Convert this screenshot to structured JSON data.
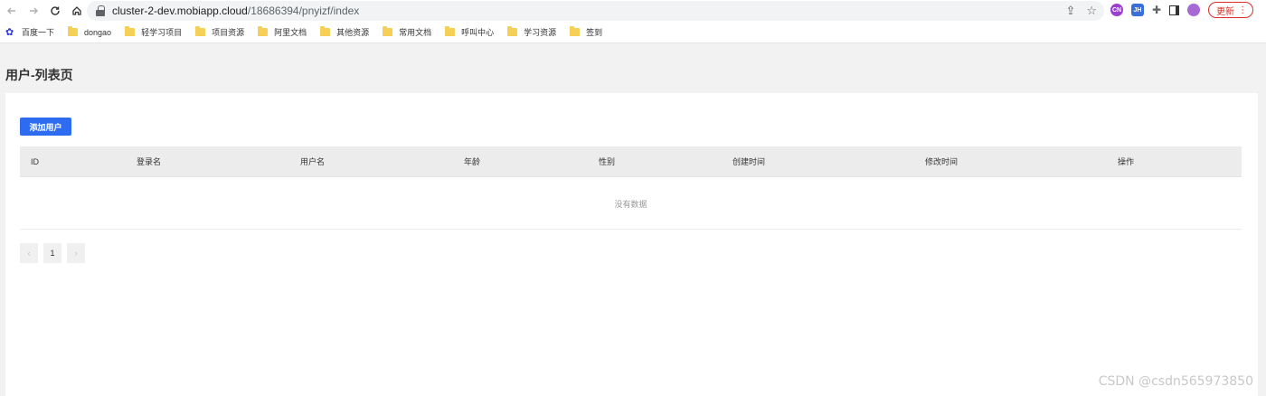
{
  "browser": {
    "url_host": "cluster-2-dev.mobiapp.cloud",
    "url_path": "/18686394/pnyizf/index",
    "update_label": "更新",
    "bookmarks": [
      {
        "label": "百度一下",
        "icon": "baidu-paw-icon"
      },
      {
        "label": "dongao",
        "icon": "folder-icon"
      },
      {
        "label": "轻学习项目",
        "icon": "folder-icon"
      },
      {
        "label": "项目资源",
        "icon": "folder-icon"
      },
      {
        "label": "阿里文档",
        "icon": "folder-icon"
      },
      {
        "label": "其他资源",
        "icon": "folder-icon"
      },
      {
        "label": "常用文档",
        "icon": "folder-icon"
      },
      {
        "label": "呼叫中心",
        "icon": "folder-icon"
      },
      {
        "label": "学习资源",
        "icon": "folder-icon"
      },
      {
        "label": "签到",
        "icon": "folder-icon"
      }
    ],
    "extensions": [
      "CN",
      "JH"
    ]
  },
  "page": {
    "title": "用户-列表页",
    "add_button": "添加用户",
    "table": {
      "columns": [
        "ID",
        "登录名",
        "用户名",
        "年龄",
        "性别",
        "创建时间",
        "修改时间",
        "操作"
      ],
      "empty_text": "没有数据"
    },
    "pagination": {
      "current": "1",
      "prev": "‹",
      "next": "›"
    }
  },
  "watermark": "CSDN @csdn565973850",
  "colors": {
    "primary": "#2d6cf0",
    "header_bg": "#ececec"
  }
}
